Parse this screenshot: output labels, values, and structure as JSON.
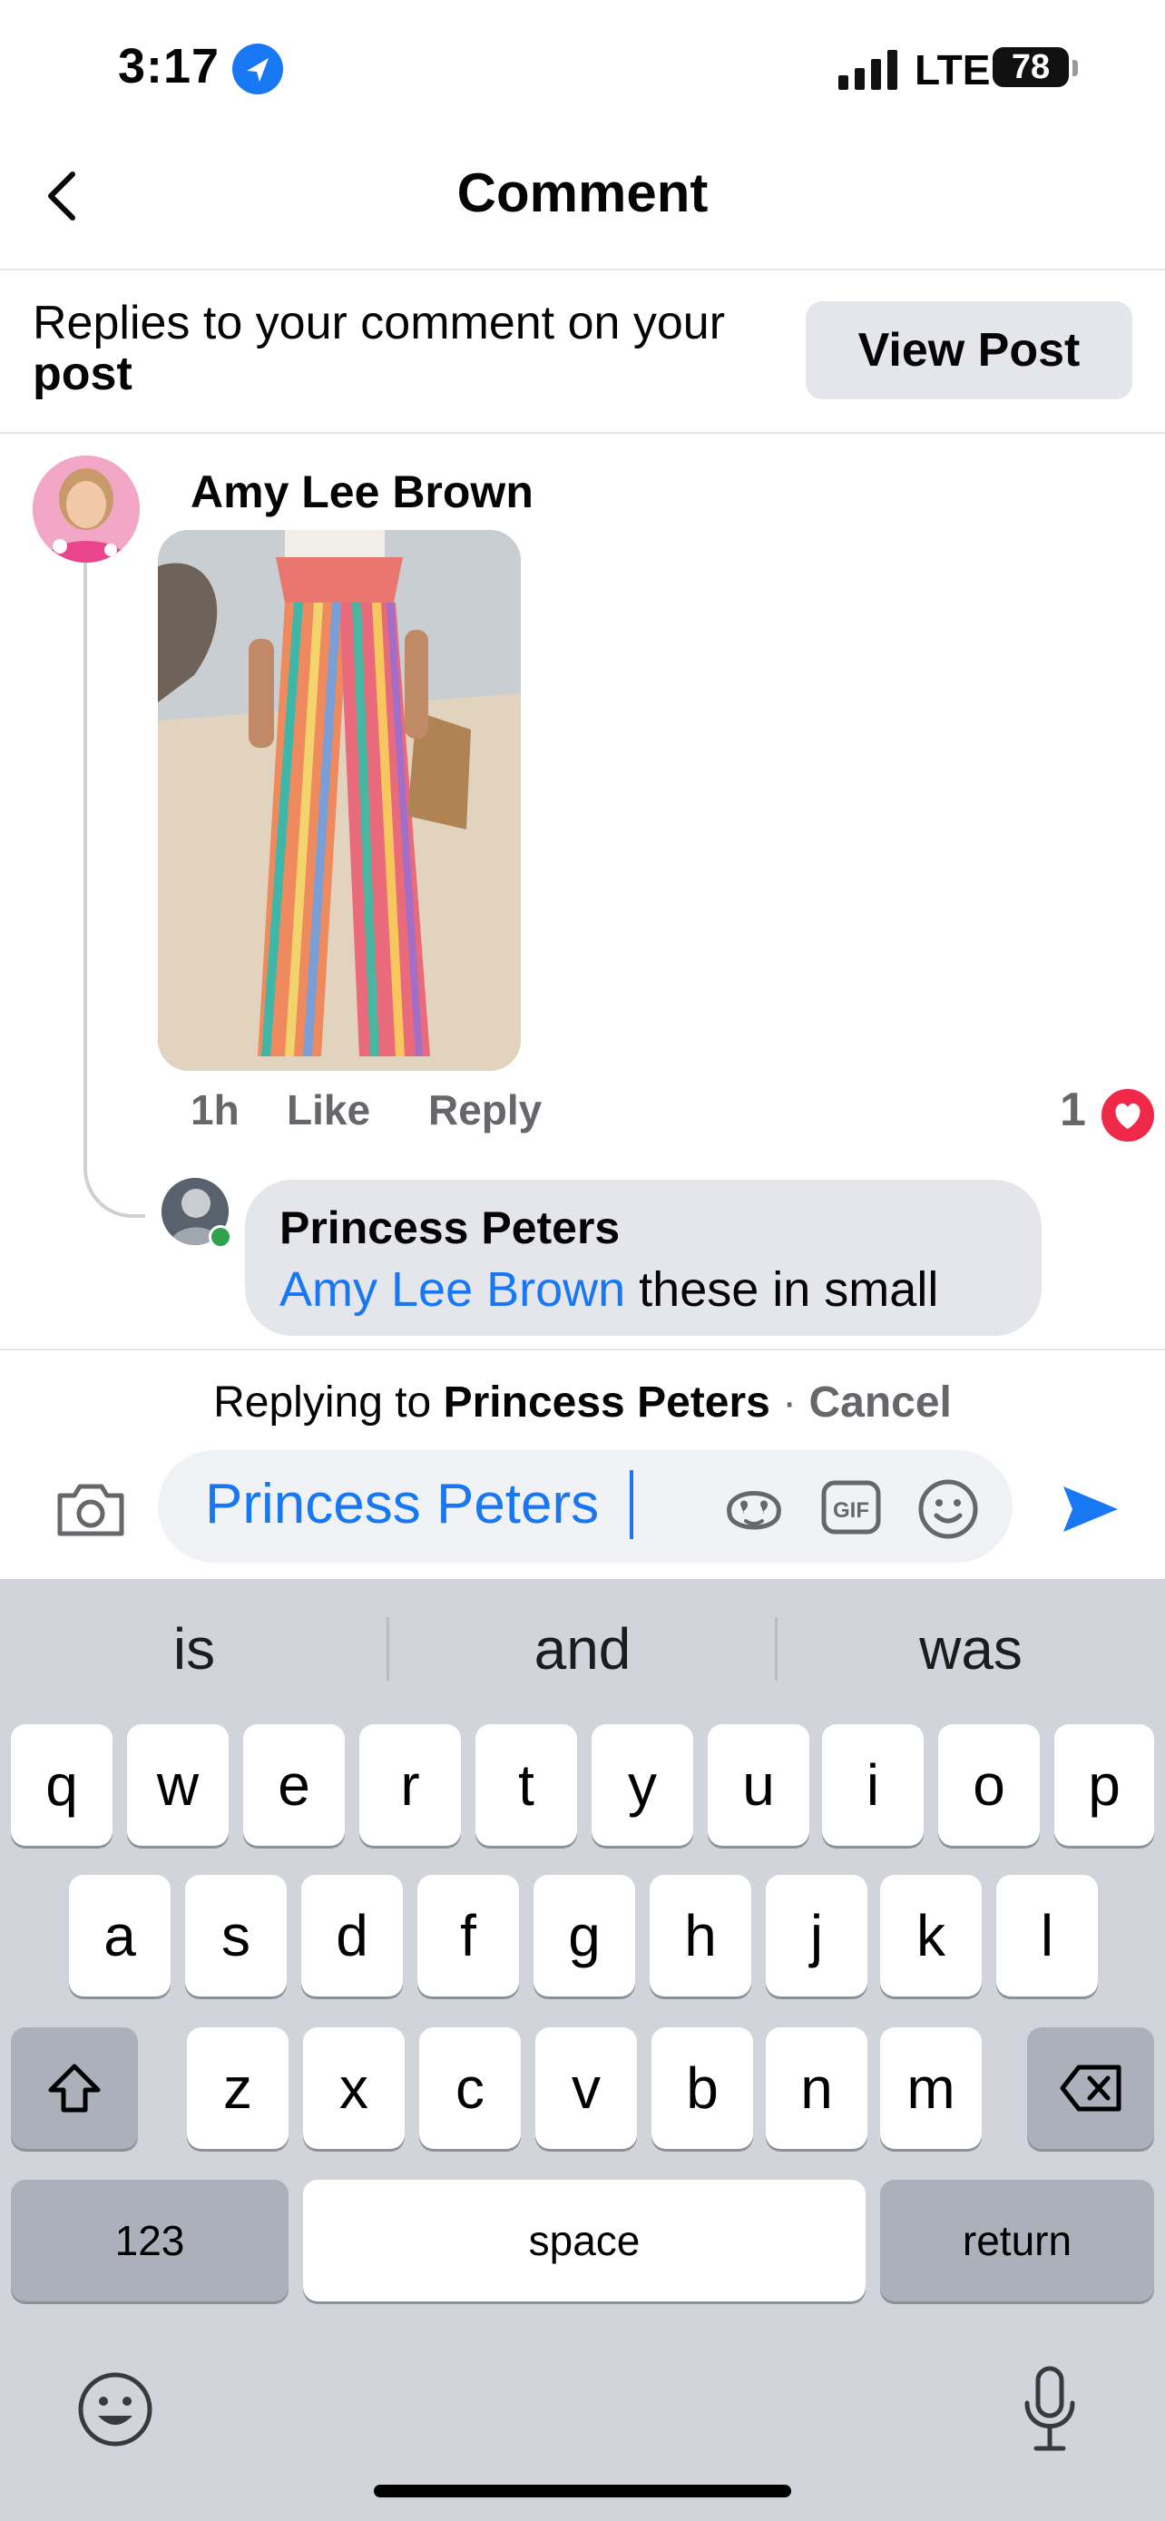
{
  "status": {
    "time": "3:17",
    "network": "LTE",
    "battery": "78"
  },
  "header": {
    "title": "Comment"
  },
  "notice": {
    "text_plain": "Replies to your comment on your ",
    "text_bold": "post",
    "view_post_label": "View Post"
  },
  "comment": {
    "author": "Amy Lee Brown",
    "time": "1h",
    "like_label": "Like",
    "reply_label": "Reply",
    "reaction_count": "1"
  },
  "reply": {
    "author": "Princess Peters",
    "mention": "Amy Lee Brown",
    "text": " these in small"
  },
  "composer": {
    "replying_prefix": "Replying to ",
    "replying_name": "Princess Peters",
    "separator": " · ",
    "cancel_label": "Cancel",
    "input_value": "Princess Peters"
  },
  "keyboard": {
    "suggestions": [
      "is",
      "and",
      "was"
    ],
    "row1": [
      "q",
      "w",
      "e",
      "r",
      "t",
      "y",
      "u",
      "i",
      "o",
      "p"
    ],
    "row2": [
      "a",
      "s",
      "d",
      "f",
      "g",
      "h",
      "j",
      "k",
      "l"
    ],
    "row3": [
      "z",
      "x",
      "c",
      "v",
      "b",
      "n",
      "m"
    ],
    "numbers_label": "123",
    "space_label": "space",
    "return_label": "return"
  },
  "icons": [
    "location-arrow-icon",
    "signal-icon",
    "back-chevron-icon",
    "camera-icon",
    "avatar-sticker-icon",
    "gif-icon",
    "smiley-icon",
    "send-icon",
    "shift-icon",
    "backspace-icon",
    "emoji-icon",
    "mic-icon"
  ],
  "colors": {
    "accent": "#1877f2",
    "heart": "#f02849",
    "keyboard_bg": "#d1d4da"
  }
}
